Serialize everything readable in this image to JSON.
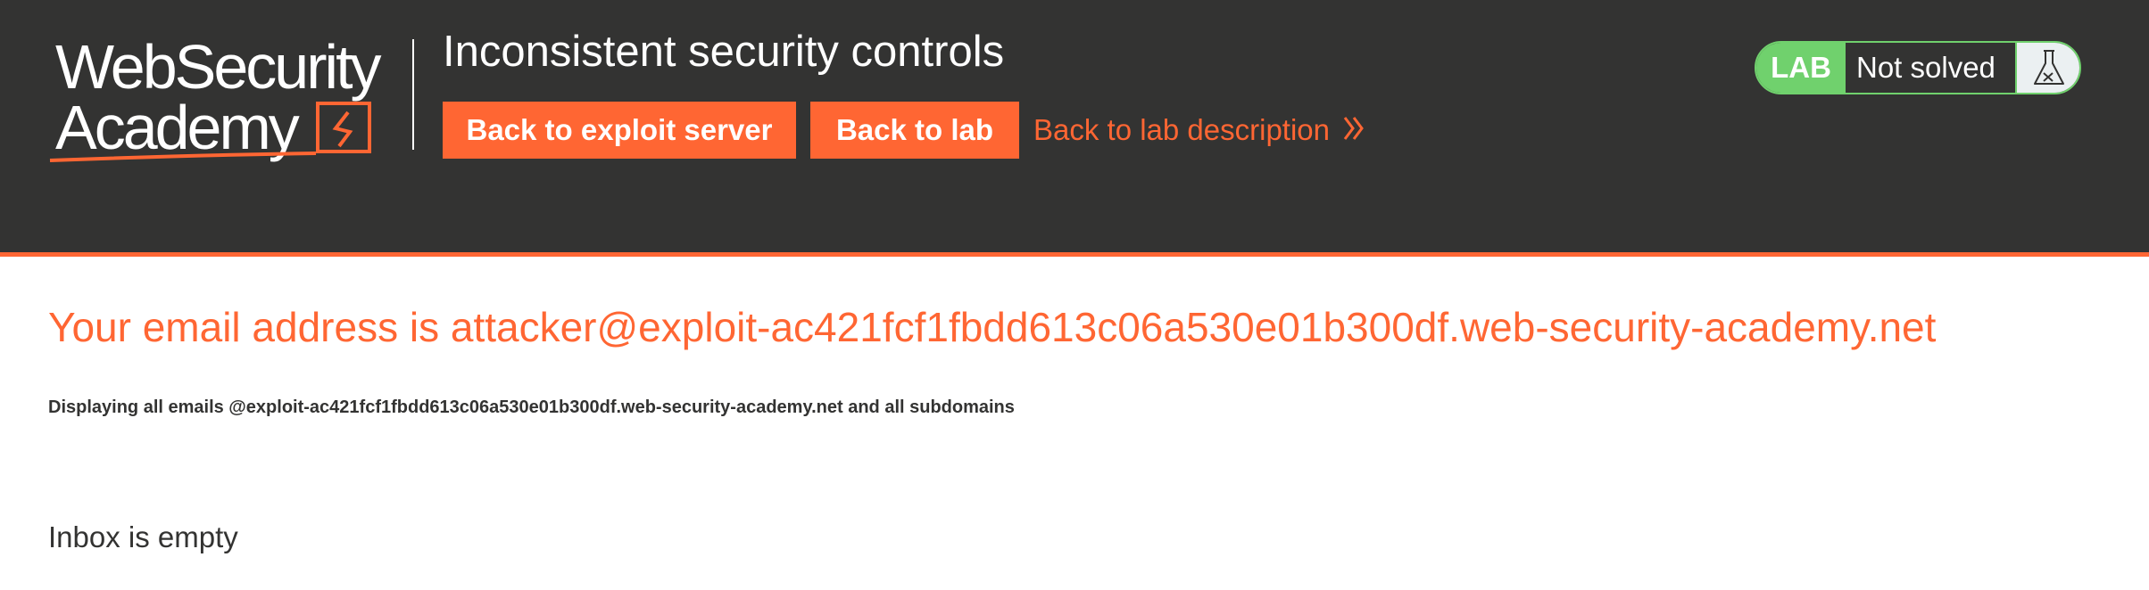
{
  "header": {
    "logo": {
      "line1": "WebSecurity",
      "line2": "Academy"
    },
    "lab_title": "Inconsistent security controls",
    "buttons": {
      "exploit_server": "Back to exploit server",
      "back_to_lab": "Back to lab"
    },
    "back_to_description": "Back to lab description",
    "status": {
      "badge": "LAB",
      "text": "Not solved",
      "icon": "flask-icon"
    }
  },
  "main": {
    "email_heading": "Your email address is attacker@exploit-ac421fcf1fbdd613c06a530e01b300df.web-security-academy.net",
    "display_note": "Displaying all emails @exploit-ac421fcf1fbdd613c06a530e01b300df.web-security-academy.net and all subdomains",
    "inbox_status": "Inbox is empty"
  },
  "colors": {
    "header_bg": "#333332",
    "accent": "#ff6633",
    "solved_green": "#70d16d",
    "text_dark": "#333332"
  }
}
